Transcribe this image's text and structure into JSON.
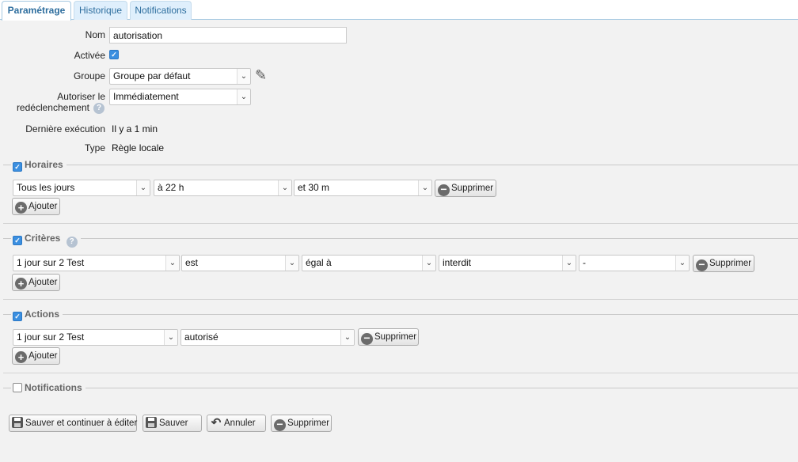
{
  "tabs": [
    "Paramétrage",
    "Historique",
    "Notifications"
  ],
  "form": {
    "name_label": "Nom",
    "name_value": "autorisation",
    "enabled_label": "Activée",
    "group_label": "Groupe",
    "group_value": "Groupe par défaut",
    "retrigger_label_1": "Autoriser le",
    "retrigger_label_2": "redéclenchement",
    "retrigger_value": "Immédiatement",
    "last_exec_label": "Dernière exécution",
    "last_exec_value": "Il y a 1 min",
    "type_label": "Type",
    "type_value": "Règle locale"
  },
  "horaires": {
    "title": "Horaires",
    "checked": true,
    "day": "Tous les jours",
    "hour": "à 22 h",
    "minute": "et 30 m",
    "delete_label": "Supprimer",
    "add_label": "Ajouter"
  },
  "criteres": {
    "title": "Critères",
    "checked": true,
    "device": "1 jour sur 2 Test",
    "verb": "est",
    "operator": "égal à",
    "value": "interdit",
    "extra": "-",
    "delete_label": "Supprimer",
    "add_label": "Ajouter"
  },
  "actions": {
    "title": "Actions",
    "checked": true,
    "device": "1 jour sur 2 Test",
    "value": "autorisé",
    "delete_label": "Supprimer",
    "add_label": "Ajouter"
  },
  "notifications": {
    "title": "Notifications",
    "checked": false
  },
  "footer": {
    "save_continue": "Sauver et continuer à éditer",
    "save": "Sauver",
    "cancel": "Annuler",
    "delete": "Supprimer"
  }
}
